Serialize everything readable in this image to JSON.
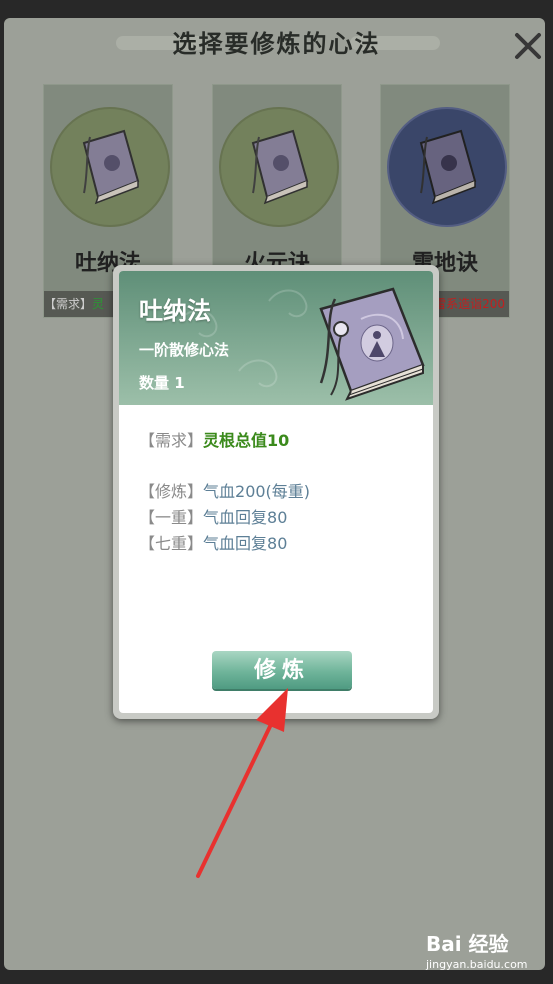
{
  "selection": {
    "title": "选择要修炼的心法",
    "cards": [
      {
        "name": "吐纳法",
        "req_prefix": "【需求】",
        "req_value": "灵",
        "req_color": "green"
      },
      {
        "name": "火元诀",
        "req_prefix": "",
        "req_value": "",
        "req_color": "green"
      },
      {
        "name": "雷地诀",
        "req_prefix": "",
        "req_value": "雷系造诣200",
        "req_color": "red"
      }
    ]
  },
  "popup": {
    "title": "吐纳法",
    "subtitle": "一阶散修心法",
    "quantity": "数量 1",
    "requirement": {
      "label": "【需求】",
      "value": "灵根总值10"
    },
    "cultivate": {
      "label": "【修炼】",
      "value": "气血200(每重)"
    },
    "level1": {
      "label": "【一重】",
      "value": "气血回复80"
    },
    "level7": {
      "label": "【七重】",
      "value": "气血回复80"
    },
    "button_label": "修炼"
  },
  "watermark": {
    "logo": "Bai 经验",
    "url": "jingyan.baidu.com"
  },
  "colors": {
    "popup_header": "#6f9e86",
    "button": "#6fb49a",
    "requirement_green": "#3b8a1c",
    "arrow": "#e8312f"
  }
}
